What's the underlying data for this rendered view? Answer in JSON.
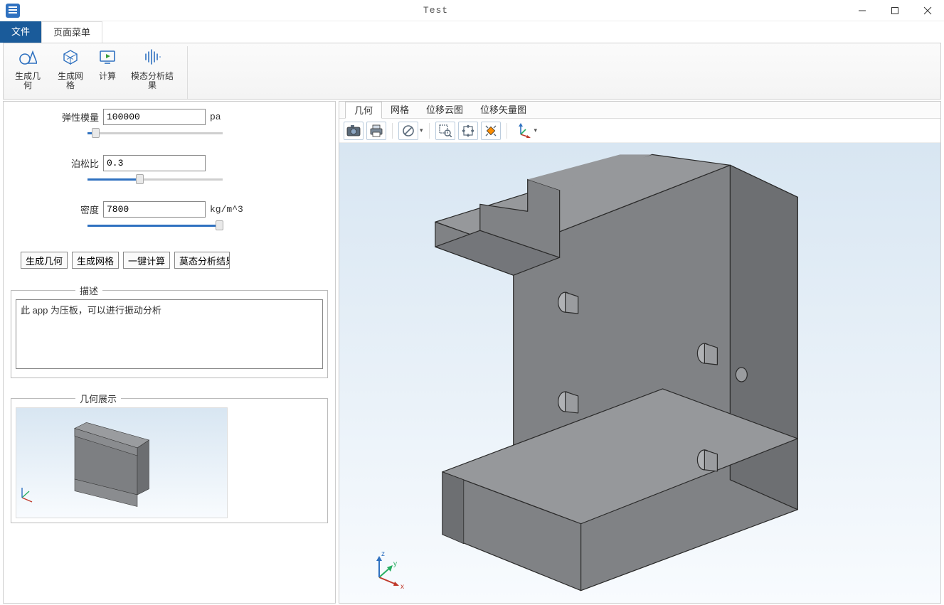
{
  "window": {
    "title": "Test",
    "tabs": {
      "file": "文件",
      "page_menu": "页面菜单"
    }
  },
  "ribbon": {
    "gen_geometry": "生成几何",
    "gen_mesh": "生成网格",
    "compute": "计算",
    "modal_results": "模态分析结果"
  },
  "params": {
    "elastic_modulus": {
      "label": "弹性模量",
      "value": "100000",
      "unit": "pa"
    },
    "poisson_ratio": {
      "label": "泊松比",
      "value": "0.3",
      "unit": ""
    },
    "density": {
      "label": "密度",
      "value": "7800",
      "unit": "kg/m^3"
    }
  },
  "buttons": {
    "gen_geometry": "生成几何",
    "gen_mesh": "生成网格",
    "one_click_compute": "一键计算",
    "modal_results": "莫态分析结果"
  },
  "description": {
    "legend": "描述",
    "text": "此 app 为压板，可以进行振动分析"
  },
  "geometry": {
    "legend": "几何展示"
  },
  "view_tabs": [
    "几何",
    "网格",
    "位移云图",
    "位移矢量图"
  ],
  "view_tabs_active": 0,
  "axes": {
    "x": "x",
    "y": "y",
    "z": "z"
  }
}
